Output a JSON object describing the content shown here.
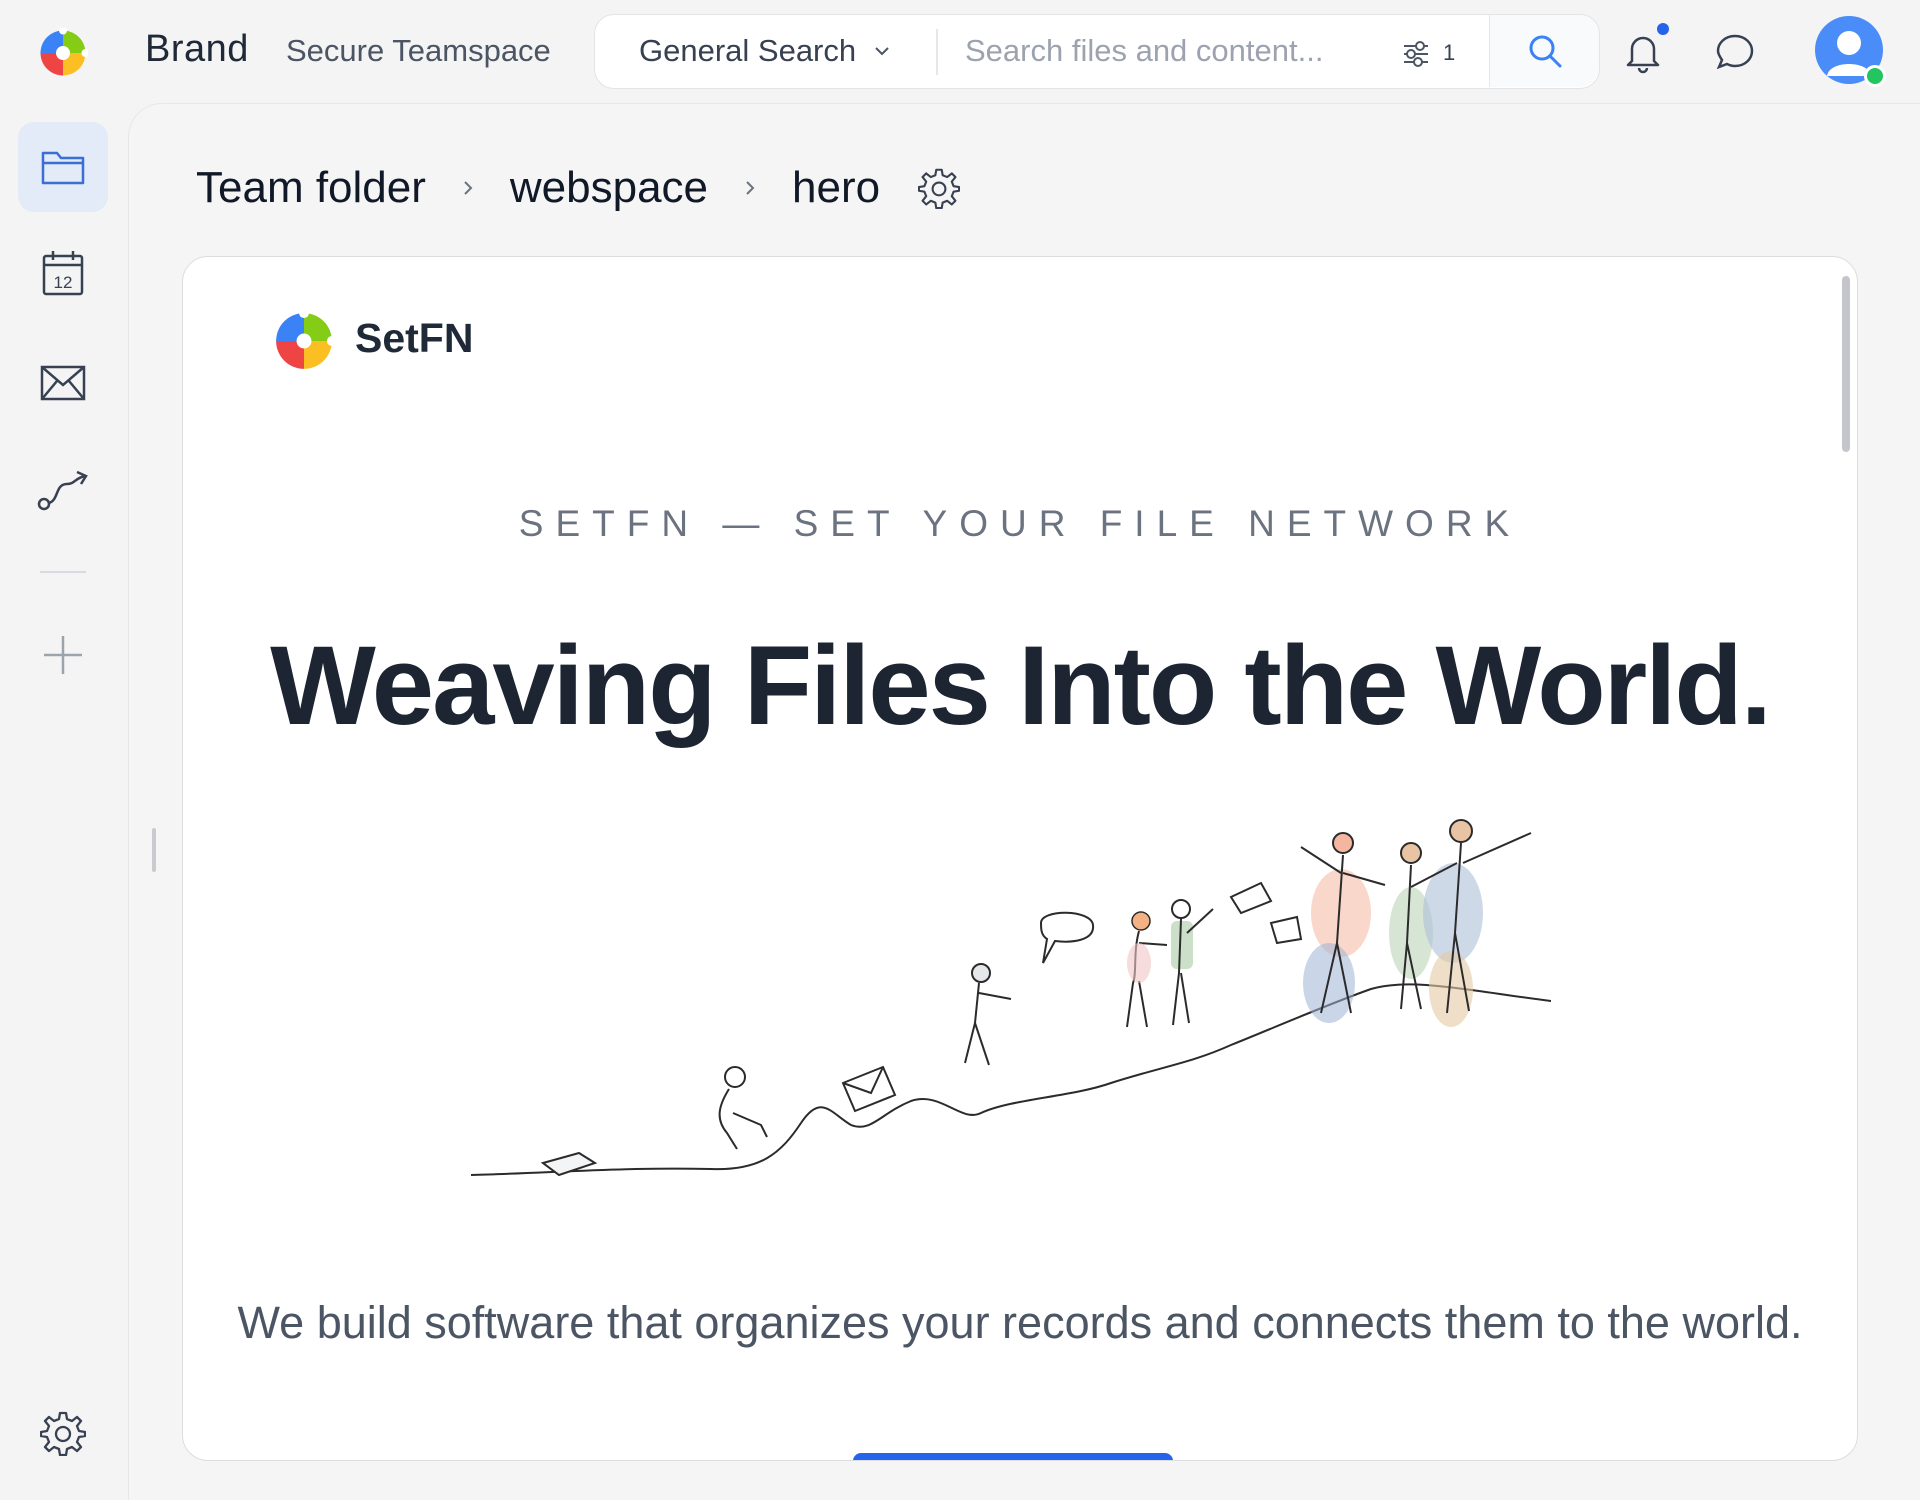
{
  "header": {
    "brand": "Brand",
    "workspace": "Secure Teamspace",
    "search": {
      "scope_label": "General Search",
      "placeholder": "Search files and content...",
      "filter_count": "1"
    },
    "notification_dot_color": "#2563eb",
    "presence_color": "#22c55e"
  },
  "sidebar": {
    "items": [
      {
        "id": "files",
        "icon": "folder-icon",
        "active": true
      },
      {
        "id": "calendar",
        "icon": "calendar-icon",
        "day": "12"
      },
      {
        "id": "mail",
        "icon": "mail-icon"
      },
      {
        "id": "workflows",
        "icon": "route-icon"
      },
      {
        "id": "add",
        "icon": "plus-icon"
      },
      {
        "id": "settings",
        "icon": "gear-icon"
      }
    ]
  },
  "breadcrumb": [
    "Team folder",
    "webspace",
    "hero"
  ],
  "preview": {
    "site_name": "SetFN",
    "eyebrow": "SETFN — SET YOUR FILE NETWORK",
    "headline": "Weaving Files Into the World.",
    "tagline": "We build software that organizes your records and connects them to the world.",
    "accent_color": "#2563eb"
  }
}
